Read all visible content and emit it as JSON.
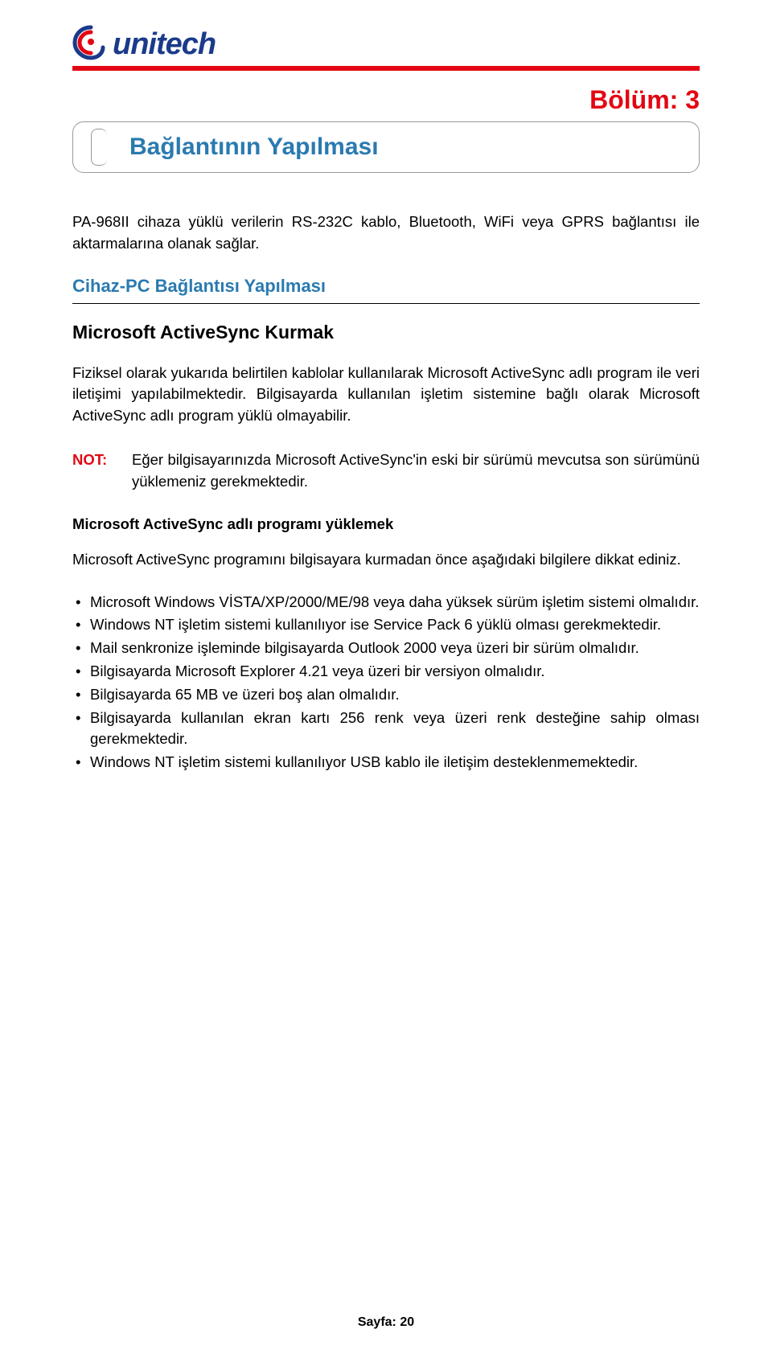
{
  "logo": {
    "text": "unitech"
  },
  "chapter_label": "Bölüm: 3",
  "title": "Bağlantının Yapılması",
  "intro": "PA-968II cihaza yüklü verilerin RS-232C kablo, Bluetooth, WiFi veya GPRS bağlantısı ile aktarmalarına olanak sağlar.",
  "section1_heading": "Cihaz-PC Bağlantısı Yapılması",
  "subhead1": "Microsoft ActiveSync Kurmak",
  "para1": "Fiziksel olarak yukarıda belirtilen kablolar kullanılarak Microsoft ActiveSync adlı program ile veri iletişimi yapılabilmektedir. Bilgisayarda kullanılan işletim sistemine bağlı olarak Microsoft ActiveSync adlı program yüklü olmayabilir.",
  "note": {
    "label": "NOT:",
    "text": "Eğer bilgisayarınızda Microsoft ActiveSync'in eski bir sürümü mevcutsa son sürümünü yüklemeniz gerekmektedir."
  },
  "subhead2": "Microsoft ActiveSync adlı programı yüklemek",
  "para2": "Microsoft ActiveSync programını bilgisayara kurmadan önce aşağıdaki bilgilere dikkat ediniz.",
  "bullets": [
    "Microsoft Windows VİSTA/XP/2000/ME/98 veya daha yüksek sürüm işletim sistemi olmalıdır.",
    "Windows NT işletim sistemi kullanılıyor ise Service Pack 6 yüklü olması gerekmektedir.",
    "Mail senkronize işleminde bilgisayarda Outlook 2000 veya üzeri bir sürüm olmalıdır.",
    "Bilgisayarda Microsoft Explorer 4.21 veya üzeri bir versiyon olmalıdır.",
    "Bilgisayarda 65 MB ve üzeri boş alan olmalıdır.",
    "Bilgisayarda kullanılan ekran kartı 256 renk veya üzeri renk desteğine sahip olması gerekmektedir.",
    "Windows NT işletim sistemi kullanılıyor USB kablo ile iletişim desteklenmemektedir."
  ],
  "footer": "Sayfa: 20"
}
